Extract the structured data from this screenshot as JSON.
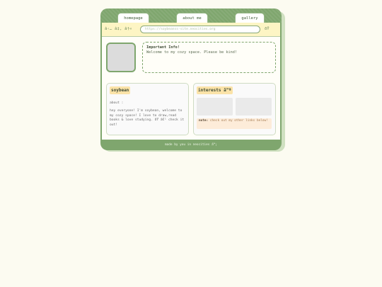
{
  "tabs": [
    "homepage",
    "about me",
    "gallery"
  ],
  "browser": {
    "nav_glyphs": "â‹… â‡, â†«",
    "url": "https://soybeanss-site.neocities.org",
    "menu_glyph": "ðŸ"
  },
  "info": {
    "title": "Important Info!",
    "text": "Welcome to my cozy space. Please be kind!"
  },
  "profile": {
    "name": "soybean",
    "about_label": "about :",
    "about_text": "hey everyone! I'm soybean, welcome to my cozy space! I love to draw,read books & love studying. ðŸ  â€¹ check it out!"
  },
  "interests": {
    "title": "interests â™ª",
    "note_label": "note:",
    "note_text": "check out my other links below!"
  },
  "footer": "made by you in neocities â™¡"
}
